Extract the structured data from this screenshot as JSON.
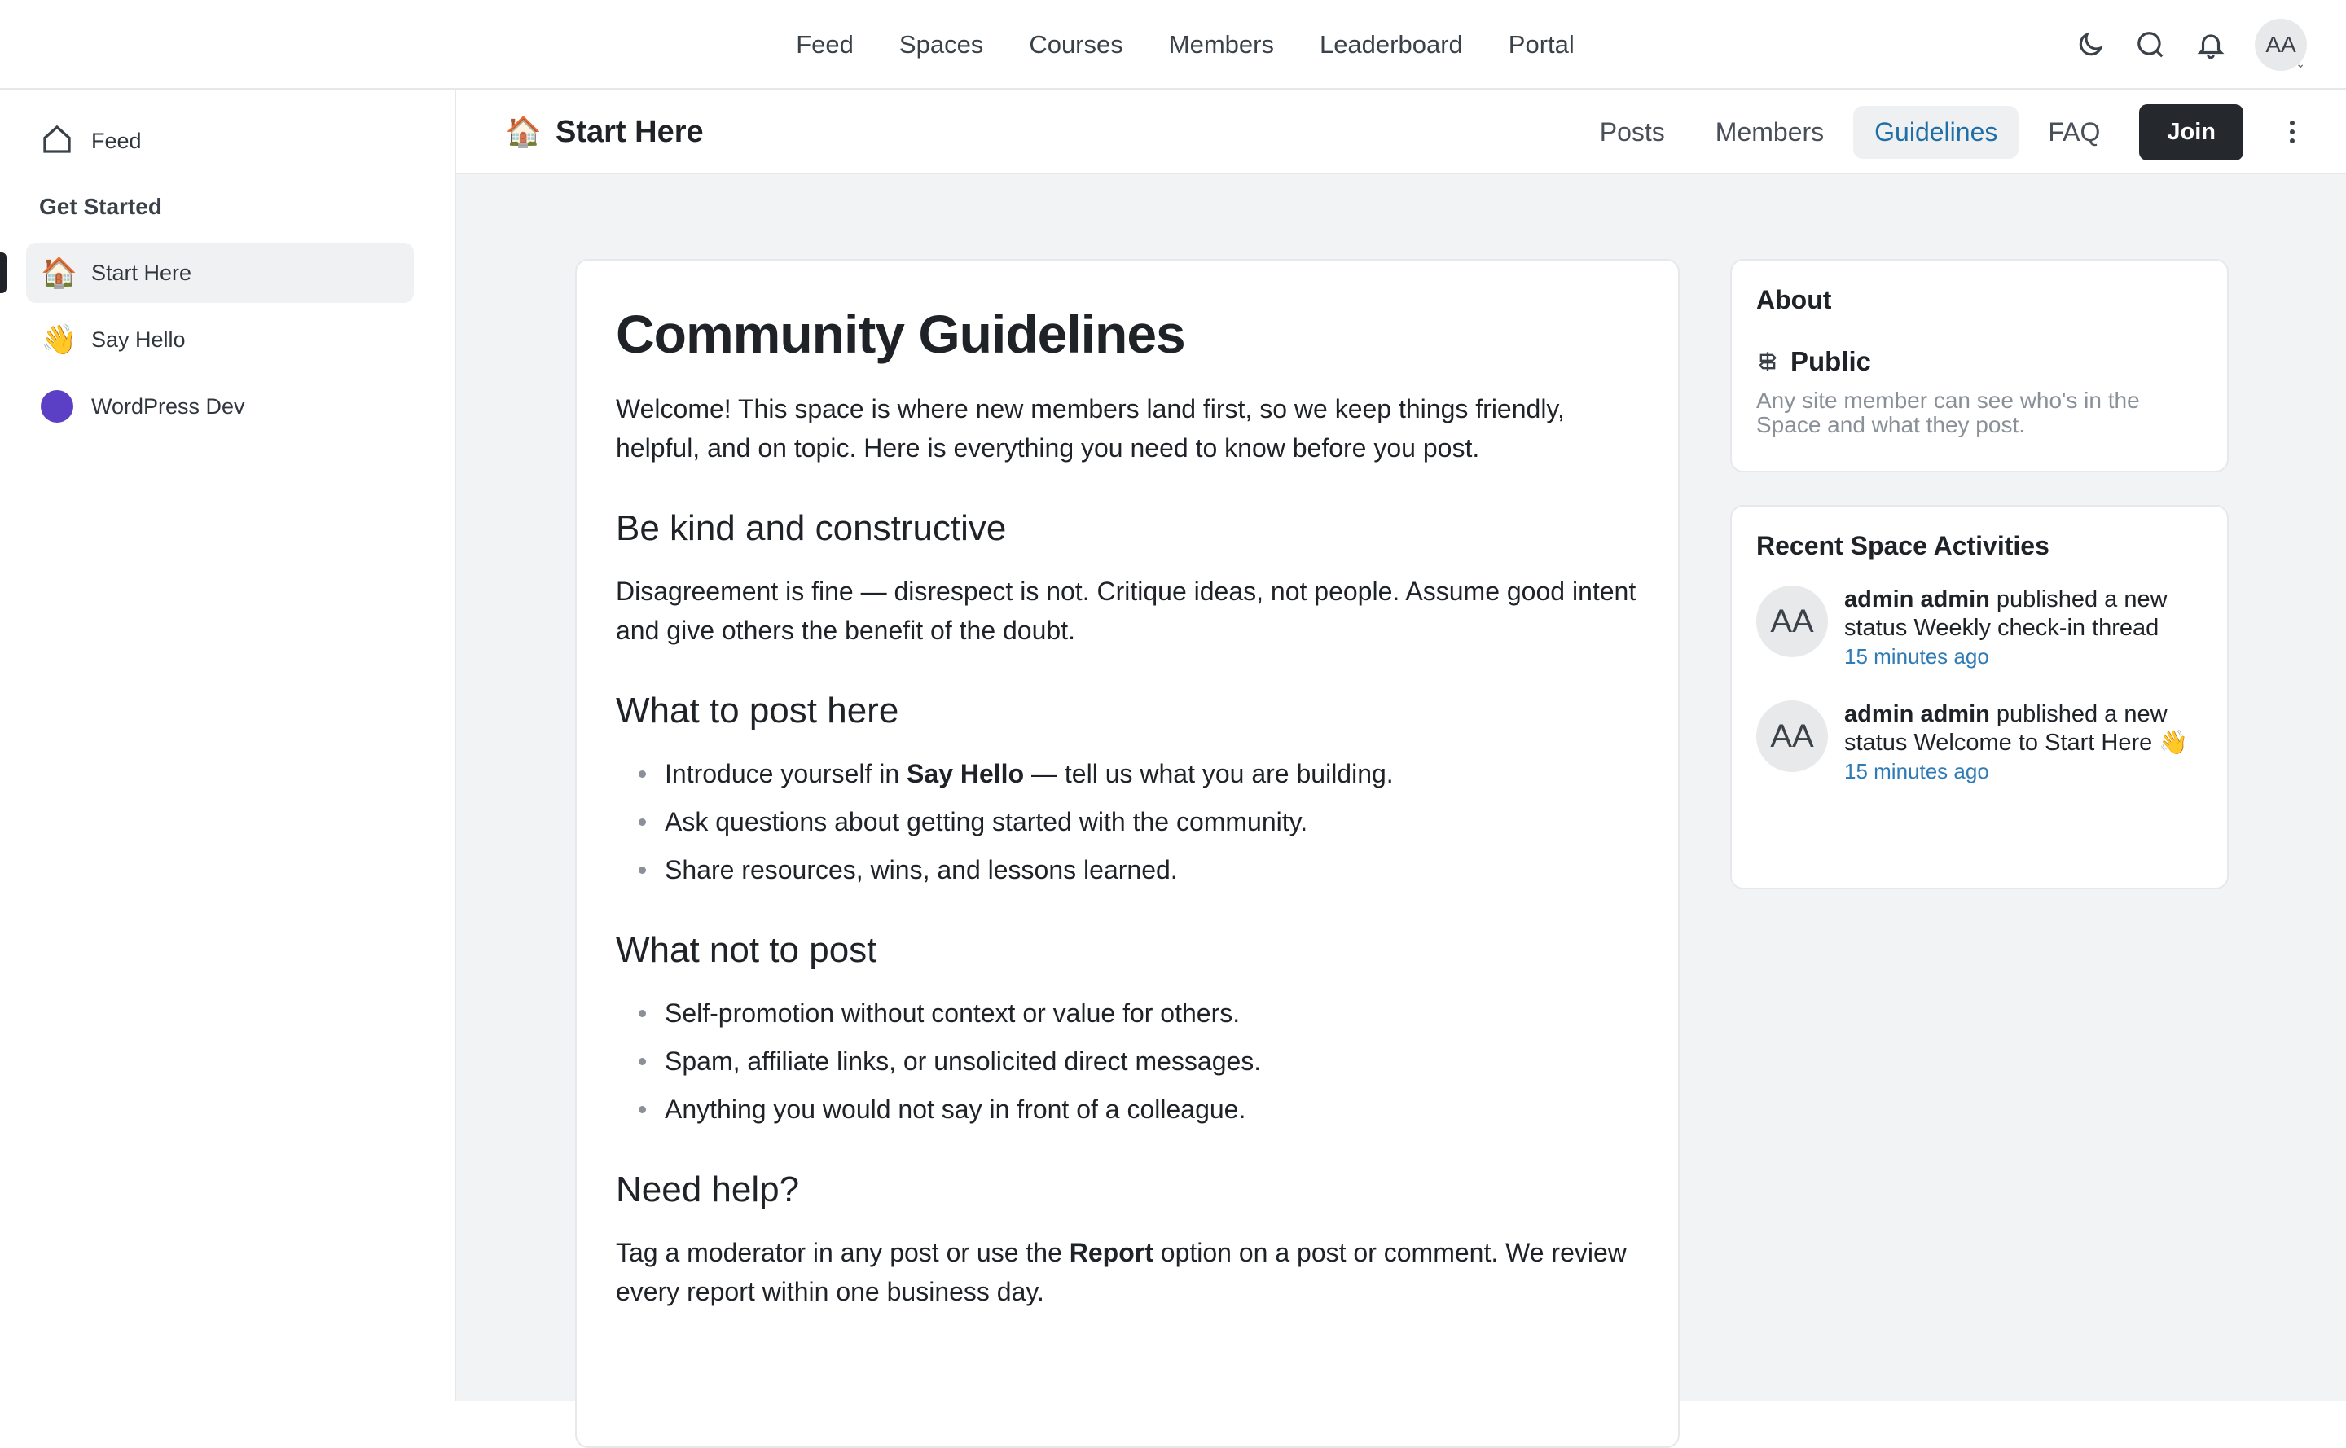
{
  "topnav": {
    "items": [
      "Feed",
      "Spaces",
      "Courses",
      "Members",
      "Leaderboard",
      "Portal"
    ],
    "avatar_initials": "AA"
  },
  "sidebar": {
    "feed_label": "Feed",
    "section_heading": "Get Started",
    "items": [
      {
        "label": "Start Here",
        "icon": "🏠"
      },
      {
        "label": "Say Hello",
        "icon": "👋"
      },
      {
        "label": "WordPress Dev",
        "icon": "purple-dot"
      }
    ]
  },
  "space": {
    "icon": "🏠",
    "title": "Start Here",
    "tabs": [
      "Posts",
      "Members",
      "Guidelines",
      "FAQ"
    ],
    "active_tab": "Guidelines",
    "join_label": "Join"
  },
  "article": {
    "title": "Community Guidelines",
    "intro": "Welcome! This space is where new members land first, so we keep things friendly, helpful, and on topic. Here is everything you need to know before you post.",
    "sections": [
      {
        "heading": "Be kind and constructive",
        "body": "Disagreement is fine — disrespect is not. Critique ideas, not people. Assume good intent and give others the benefit of the doubt."
      },
      {
        "heading": "What to post here",
        "items": [
          {
            "pre": "Introduce yourself in ",
            "bold": "Say Hello",
            "post": " — tell us what you are building."
          },
          {
            "pre": "Ask questions about getting started with the community.",
            "bold": "",
            "post": ""
          },
          {
            "pre": "Share resources, wins, and lessons learned.",
            "bold": "",
            "post": ""
          }
        ]
      },
      {
        "heading": "What not to post",
        "items": [
          "Self-promotion without context or value for others.",
          "Spam, affiliate links, or unsolicited direct messages.",
          "Anything you would not say in front of a colleague."
        ]
      },
      {
        "heading": "Need help?",
        "body_pre": "Tag a moderator in any post or use the ",
        "body_bold": "Report",
        "body_post": " option on a post or comment. We review every report within one business day."
      }
    ]
  },
  "about": {
    "title": "About",
    "privacy": "Public",
    "description": "Any site member can see who's in the Space and what they post."
  },
  "activities": {
    "title": "Recent Space Activities",
    "items": [
      {
        "avatar": "AA",
        "user": "admin admin",
        "action": " published a new status ",
        "target": "Weekly check-in thread",
        "time": "15 minutes ago"
      },
      {
        "avatar": "AA",
        "user": "admin admin",
        "action": " published a new status ",
        "target": "Welcome to Start Here 👋",
        "time": "15 minutes ago"
      }
    ]
  }
}
